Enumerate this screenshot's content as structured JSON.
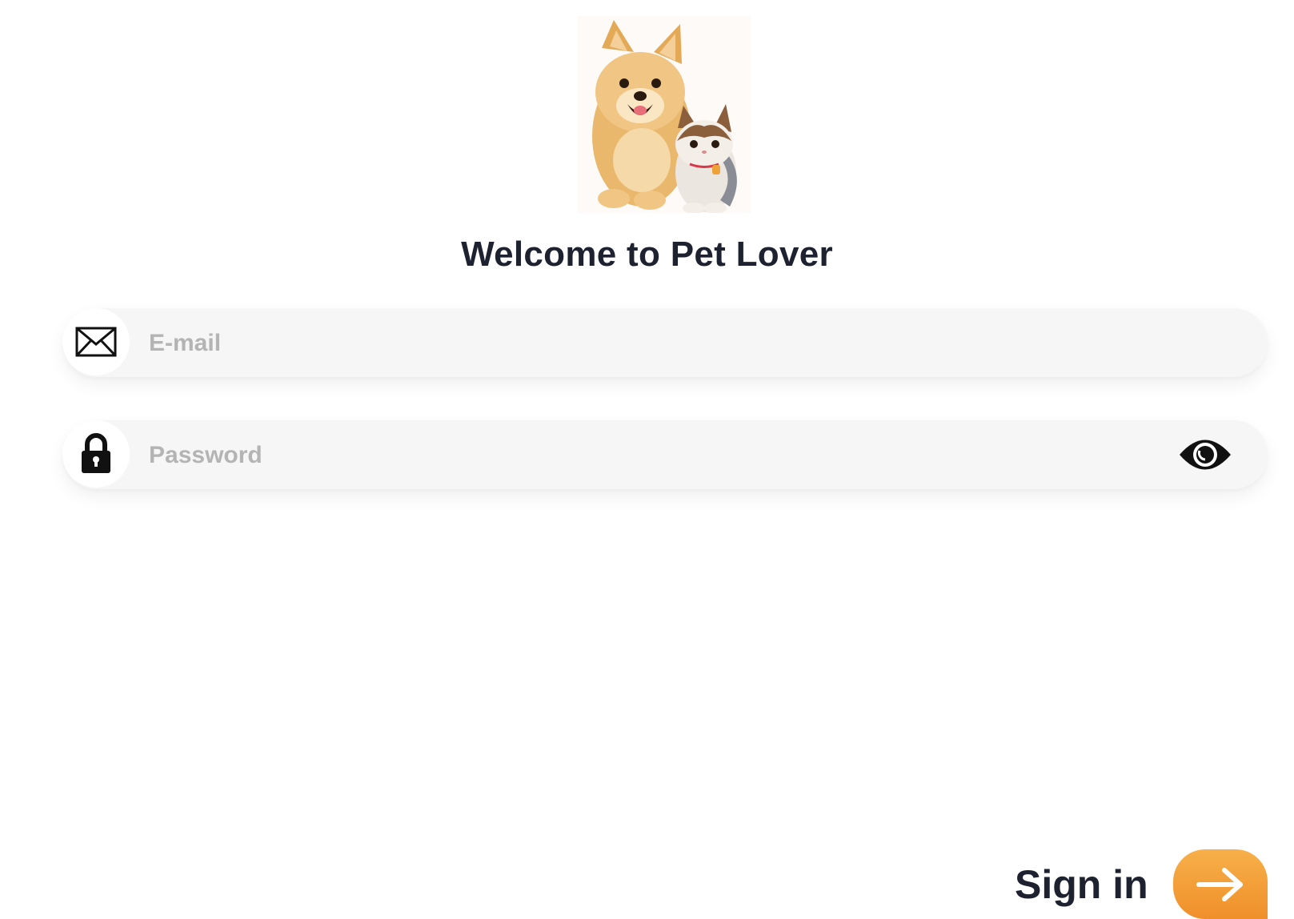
{
  "app": {
    "title": "Welcome to Pet Lover",
    "logo_icon": "dog-and-cat-logo"
  },
  "form": {
    "email": {
      "placeholder": "E-mail",
      "value": "",
      "icon": "envelope-icon"
    },
    "password": {
      "placeholder": "Password",
      "value": "",
      "icon": "lock-icon",
      "toggle_icon": "eye-icon"
    }
  },
  "signin": {
    "label": "Sign in",
    "button_icon": "arrow-right-icon"
  },
  "colors": {
    "accent": "#f39a34",
    "field_bg": "#f6f6f6",
    "title": "#1d2130",
    "placeholder": "#b4b4b4"
  }
}
